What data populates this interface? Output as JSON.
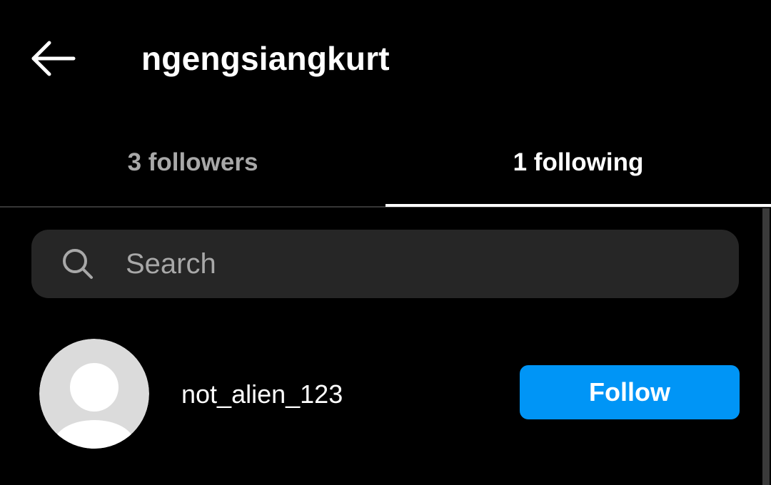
{
  "header": {
    "back_icon": "arrow-left-icon",
    "title": "ngengsiangkurt"
  },
  "tabs": [
    {
      "label": "3 followers",
      "active": false
    },
    {
      "label": "1 following",
      "active": true
    }
  ],
  "search": {
    "icon": "search-icon",
    "placeholder": "Search",
    "value": ""
  },
  "following_list": [
    {
      "avatar_icon": "default-avatar-icon",
      "username": "not_alien_123",
      "button_label": "Follow"
    }
  ],
  "colors": {
    "background": "#000000",
    "text_primary": "#ffffff",
    "text_secondary": "#a8a8a8",
    "search_background": "#262626",
    "accent": "#0095f6"
  }
}
